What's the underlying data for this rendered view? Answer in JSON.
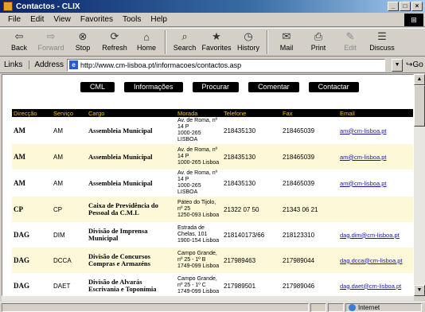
{
  "window": {
    "title": "Contactos - CLIX",
    "buttons": [
      "_",
      "□",
      "×"
    ]
  },
  "menu": [
    "File",
    "Edit",
    "View",
    "Favorites",
    "Tools",
    "Help"
  ],
  "toolbar": [
    {
      "label": "Back",
      "icon": "⇦"
    },
    {
      "label": "Forward",
      "icon": "⇨"
    },
    {
      "label": "Stop",
      "icon": "⊗"
    },
    {
      "label": "Refresh",
      "icon": "⟳"
    },
    {
      "label": "Home",
      "icon": "⌂"
    },
    {
      "label": "Search",
      "icon": "⌕"
    },
    {
      "label": "Favorites",
      "icon": "★"
    },
    {
      "label": "History",
      "icon": "◷"
    },
    {
      "label": "Mail",
      "icon": "✉"
    },
    {
      "label": "Print",
      "icon": "⎙"
    },
    {
      "label": "Edit",
      "icon": "✎"
    },
    {
      "label": "Discuss",
      "icon": "☰"
    }
  ],
  "address": {
    "links_label": "Links",
    "label": "Address",
    "url": "http://www.cm-lisboa.pt/informacoes/contactos.asp",
    "go_label": "Go"
  },
  "nav": [
    "CML",
    "Informações",
    "Procurar",
    "Comentar",
    "Contactar"
  ],
  "table": {
    "headers": [
      "Direcção",
      "Serviço",
      "Cargo",
      "Morada",
      "Telefone",
      "Fax",
      "Email"
    ],
    "rows": [
      {
        "dir": "AM",
        "servico": "AM",
        "cargo": "Assembleia Municipal",
        "morada": "Av. de Roma, nº 14 P\n1000-265\nLISBOA",
        "telefone": "218435130",
        "fax": "218465039",
        "email": "am@cm-lisboa.pt"
      },
      {
        "dir": "AM",
        "servico": "AM",
        "cargo": "Assembleia Municipal",
        "morada": "Av. de Roma, nº 14 P\n1000-265 Lisboa",
        "telefone": "218435130",
        "fax": "218465039",
        "email": "am@cm-lisboa.pt"
      },
      {
        "dir": "AM",
        "servico": "AM",
        "cargo": "Assembleia Municipal",
        "morada": "Av. de Roma, nº 14 P\n1000-265\nLISBOA",
        "telefone": "218435130",
        "fax": "218465039",
        "email": "am@cm-lisboa.pt"
      },
      {
        "dir": "CP",
        "servico": "CP",
        "cargo": "Caixa de Previdência do Pessoal da C.M.L",
        "morada": "Páteo do Tijolo, nº 25\n1250-093 Lisboa",
        "telefone": "21322 07 50",
        "fax": "21343 06 21",
        "email": ""
      },
      {
        "dir": "DAG",
        "servico": "DIM",
        "cargo": "Divisão de Imprensa Municipal",
        "morada": "Estrada de Chelas, 101\n1900-154 Lisboa",
        "telefone": "218140173/66",
        "fax": "218123310",
        "email": "dag.dim@cm-lisboa.pt"
      },
      {
        "dir": "DAG",
        "servico": "DCCA",
        "cargo": "Divisão de Concursos Compras e Armazéns",
        "morada": "Campo Grande, nº 25 - 1º B\n1749-099 Lisboa",
        "telefone": "217989463",
        "fax": "217989044",
        "email": "dag.dcca@cm-lisboa.pt"
      },
      {
        "dir": "DAG",
        "servico": "DAET",
        "cargo": "Divisão de Alvarás Escrivania e Toponímia",
        "morada": "Campo Grande, nº 25 - 1º C\n1749-099 Lisboa",
        "telefone": "217989501",
        "fax": "217989046",
        "email": "dag.daet@cm-lisboa.pt"
      }
    ]
  },
  "status": {
    "left": "",
    "zone": "Internet"
  }
}
